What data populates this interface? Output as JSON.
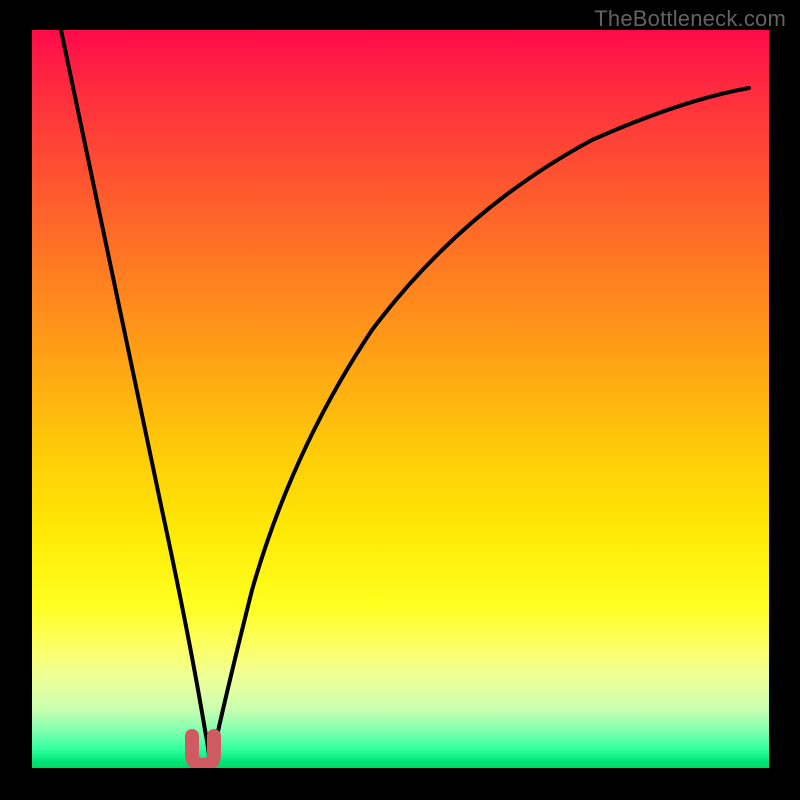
{
  "watermark": "TheBottleneck.com",
  "colors": {
    "page_bg": "#000000",
    "gradient_top": "#ff0a4a",
    "gradient_bottom": "#00d860",
    "curve_stroke": "#000000",
    "marker_stroke": "#cf5a61"
  },
  "chart_data": {
    "type": "line",
    "title": "",
    "xlabel": "",
    "ylabel": "",
    "xlim": [
      0,
      100
    ],
    "ylim": [
      0,
      100
    ],
    "note": "Axes are unlabeled percentage scales inferred from bottleneck-style chart; y=100 at top, y=0 at bottom. Two curves descend to a common minimum near x≈23, marked by a short U-shaped highlight.",
    "series": [
      {
        "name": "left-curve",
        "x": [
          4,
          7,
          10,
          13,
          16,
          19,
          21,
          22.5,
          24
        ],
        "values": [
          100,
          87,
          73,
          59,
          44,
          28,
          13,
          4,
          0
        ]
      },
      {
        "name": "right-curve",
        "x": [
          24,
          26,
          29,
          33,
          38,
          44,
          51,
          59,
          68,
          78,
          88,
          97
        ],
        "values": [
          0,
          8,
          20,
          33,
          45,
          56,
          65,
          73,
          79,
          84,
          88,
          91
        ]
      }
    ],
    "marker": {
      "name": "optimal-point-u",
      "x_center": 23,
      "y_bottom": 0,
      "width": 3.5,
      "height": 3
    }
  }
}
